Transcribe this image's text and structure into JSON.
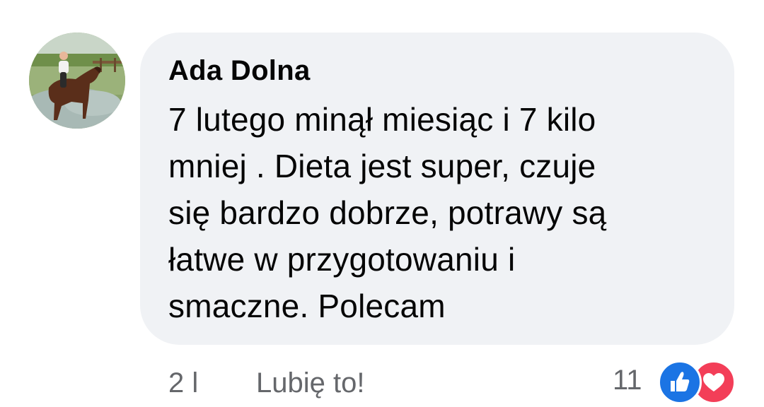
{
  "comment": {
    "author": "Ada Dolna",
    "text_lines": [
      "7 lutego minął miesiąc i 7 kilo",
      "mniej . Dieta jest super, czuje",
      "się bardzo dobrze, potrawy są",
      "łatwe w przygotowaniu i",
      "smaczne. Polecam"
    ],
    "time": "2 l",
    "like_action": "Lubię to!",
    "reaction_count": "11",
    "reactions": [
      "like-icon",
      "love-icon"
    ]
  },
  "colors": {
    "bubble": "#f0f2f5",
    "text": "#050505",
    "secondary": "#65676b",
    "like": "#1b74e4",
    "love": "#f33e58"
  }
}
